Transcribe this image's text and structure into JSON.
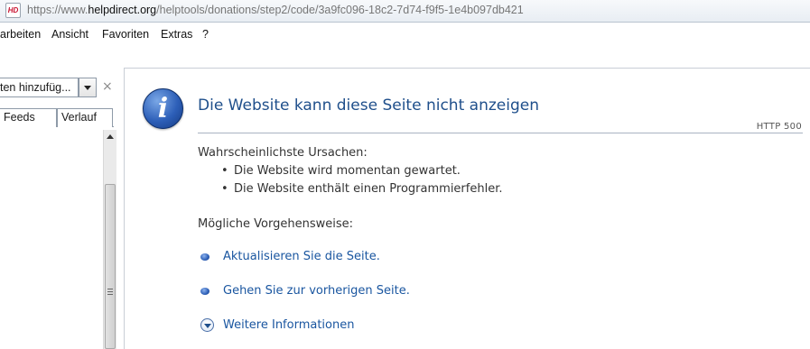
{
  "address_bar": {
    "favicon_text": "HD",
    "url_prefix": "https://www.",
    "url_domain": "helpdirect.org",
    "url_path": "/helptools/donations/step2/code/3a9fc096-18c2-7d74-f9f5-1e4b097db421"
  },
  "menu": {
    "items": [
      "arbeiten",
      "Ansicht",
      "Favoriten",
      "Extras",
      "?"
    ]
  },
  "sidebar": {
    "combo_value": "ten hinzufüg...",
    "close_glyph": "×",
    "tabs": [
      "Feeds",
      "Verlauf"
    ]
  },
  "error_page": {
    "icon": "info-icon",
    "title": "Die Website kann diese Seite nicht anzeigen",
    "error_code": "HTTP 500",
    "causes_heading": "Wahrscheinlichste Ursachen:",
    "causes": [
      "Die Website wird momentan gewartet.",
      "Die Website enthält einen Programmierfehler."
    ],
    "actions_heading": "Mögliche Vorgehensweise:",
    "actions": [
      {
        "icon": "bullet-icon",
        "label": "Aktualisieren Sie die Seite."
      },
      {
        "icon": "bullet-icon",
        "label": "Gehen Sie zur vorherigen Seite."
      },
      {
        "icon": "expand-down-icon",
        "label": "Weitere Informationen"
      }
    ]
  },
  "colors": {
    "title_blue": "#1f4f8b",
    "link_blue": "#1a56a0",
    "rule_gray": "#a9b3c2"
  }
}
